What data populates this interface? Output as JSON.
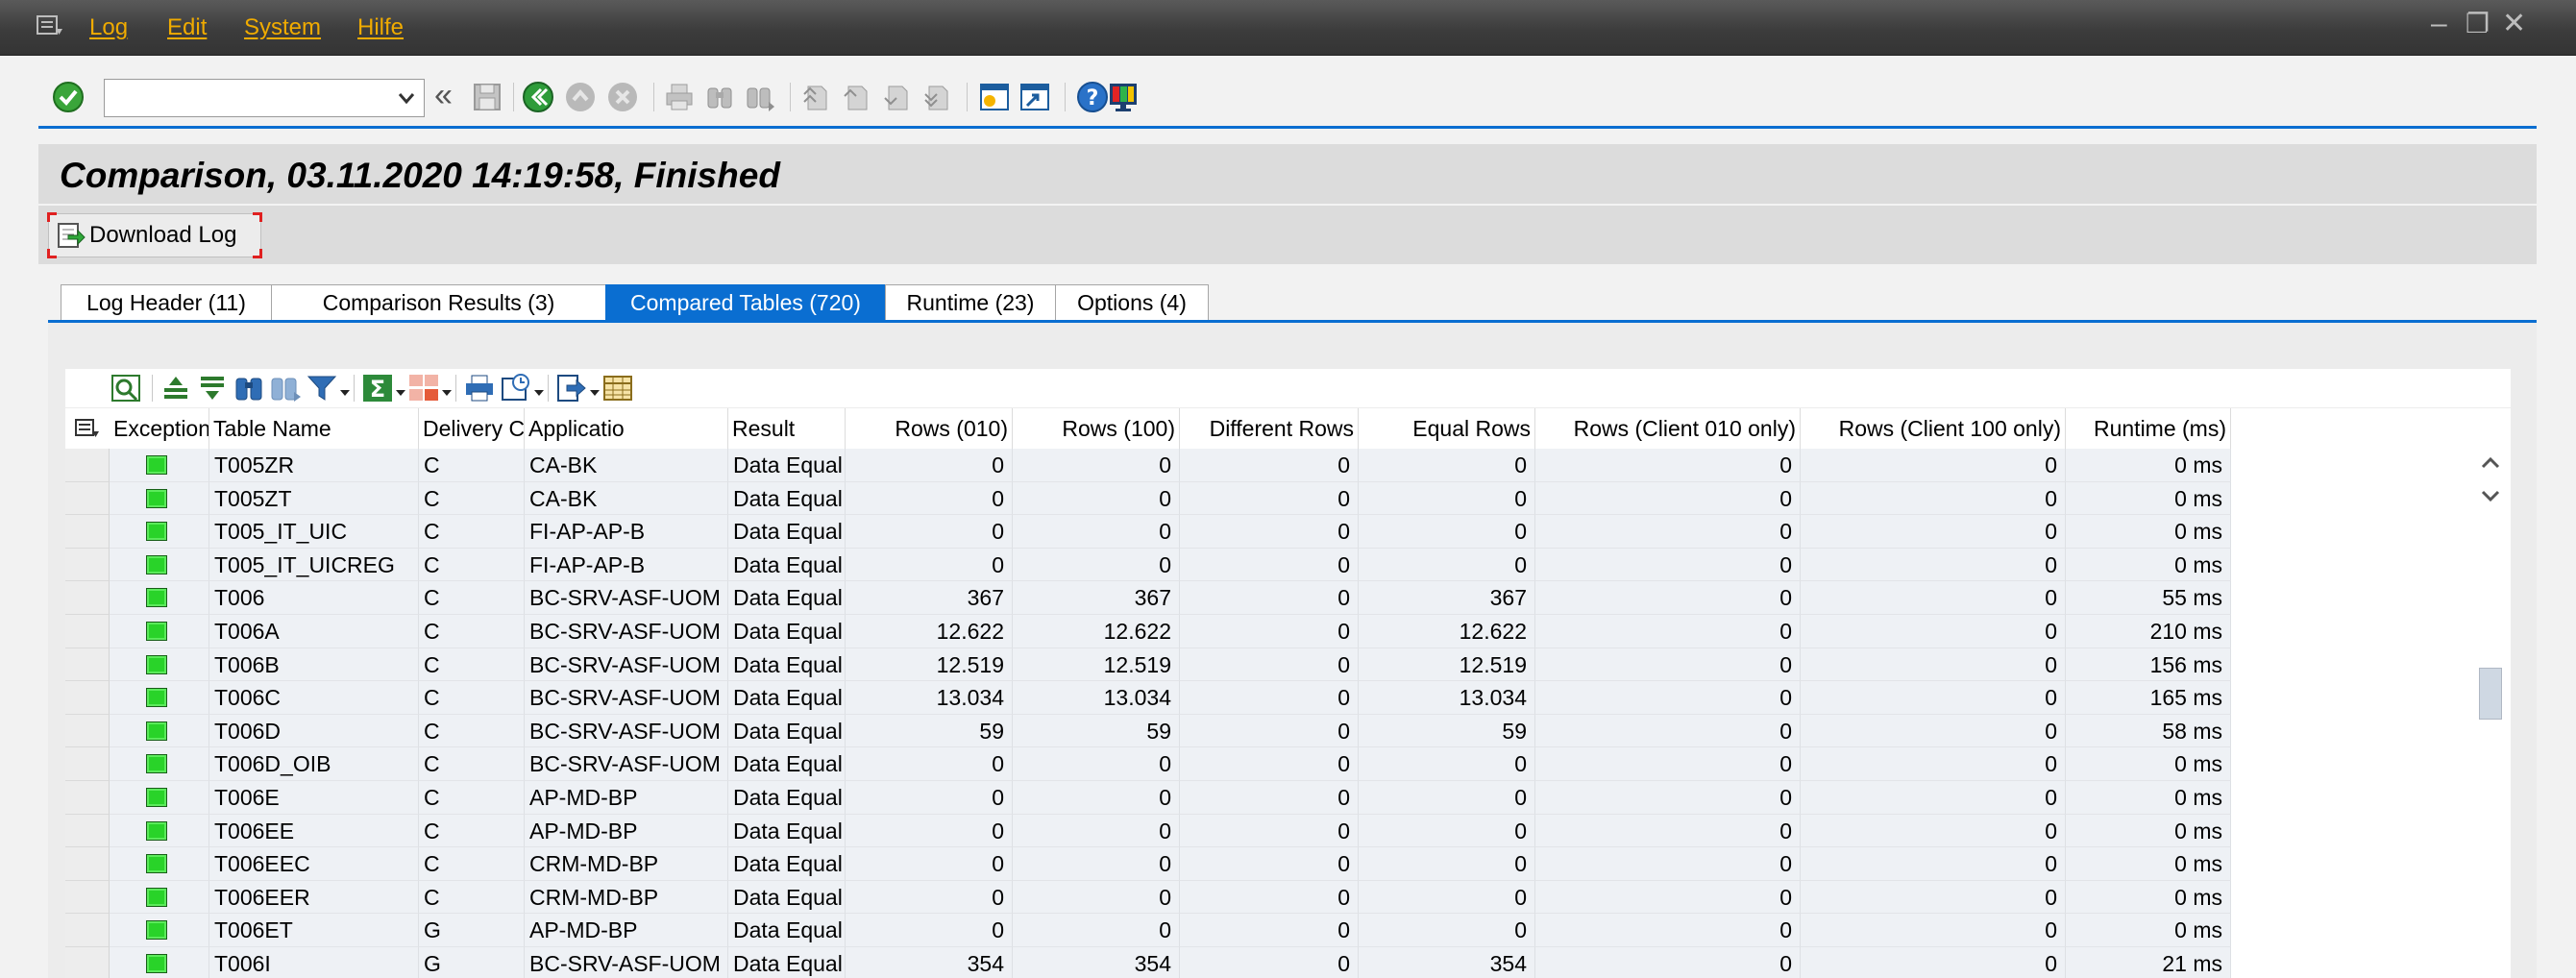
{
  "menubar": {
    "items": [
      "Log",
      "Edit",
      "System",
      "Hilfe"
    ],
    "window_controls": [
      "–",
      "❐",
      "✕"
    ]
  },
  "toolbar": {
    "command_value": "",
    "collapse_symbol": "«"
  },
  "title": "Comparison, 03.11.2020 14:19:58, Finished",
  "download_button_label": "Download Log",
  "tabs": [
    {
      "label": "Log Header (11)"
    },
    {
      "label": "Comparison Results (3)"
    },
    {
      "label": "Compared Tables (720)"
    },
    {
      "label": "Runtime (23)"
    },
    {
      "label": "Options (4)"
    }
  ],
  "active_tab": 2,
  "grid": {
    "columns": [
      "Exception",
      "Table Name",
      "Delivery C",
      "Applicatio",
      "Result",
      "Rows (010)",
      "Rows (100)",
      "Different Rows",
      "Equal Rows",
      "Rows (Client 010 only)",
      "Rows (Client 100 only)",
      "Runtime (ms)"
    ],
    "rows": [
      {
        "table": "T005ZR",
        "delivery": "C",
        "app": "CA-BK",
        "result": "Data Equal",
        "rows010": "0",
        "rows100": "0",
        "diff": "0",
        "equal": "0",
        "only010": "0",
        "only100": "0",
        "runtime": "0 ms"
      },
      {
        "table": "T005ZT",
        "delivery": "C",
        "app": "CA-BK",
        "result": "Data Equal",
        "rows010": "0",
        "rows100": "0",
        "diff": "0",
        "equal": "0",
        "only010": "0",
        "only100": "0",
        "runtime": "0 ms"
      },
      {
        "table": "T005_IT_UIC",
        "delivery": "C",
        "app": "FI-AP-AP-B",
        "result": "Data Equal",
        "rows010": "0",
        "rows100": "0",
        "diff": "0",
        "equal": "0",
        "only010": "0",
        "only100": "0",
        "runtime": "0 ms"
      },
      {
        "table": "T005_IT_UICREG",
        "delivery": "C",
        "app": "FI-AP-AP-B",
        "result": "Data Equal",
        "rows010": "0",
        "rows100": "0",
        "diff": "0",
        "equal": "0",
        "only010": "0",
        "only100": "0",
        "runtime": "0 ms"
      },
      {
        "table": "T006",
        "delivery": "C",
        "app": "BC-SRV-ASF-UOM",
        "result": "Data Equal",
        "rows010": "367",
        "rows100": "367",
        "diff": "0",
        "equal": "367",
        "only010": "0",
        "only100": "0",
        "runtime": "55 ms"
      },
      {
        "table": "T006A",
        "delivery": "C",
        "app": "BC-SRV-ASF-UOM",
        "result": "Data Equal",
        "rows010": "12.622",
        "rows100": "12.622",
        "diff": "0",
        "equal": "12.622",
        "only010": "0",
        "only100": "0",
        "runtime": "210 ms"
      },
      {
        "table": "T006B",
        "delivery": "C",
        "app": "BC-SRV-ASF-UOM",
        "result": "Data Equal",
        "rows010": "12.519",
        "rows100": "12.519",
        "diff": "0",
        "equal": "12.519",
        "only010": "0",
        "only100": "0",
        "runtime": "156 ms"
      },
      {
        "table": "T006C",
        "delivery": "C",
        "app": "BC-SRV-ASF-UOM",
        "result": "Data Equal",
        "rows010": "13.034",
        "rows100": "13.034",
        "diff": "0",
        "equal": "13.034",
        "only010": "0",
        "only100": "0",
        "runtime": "165 ms"
      },
      {
        "table": "T006D",
        "delivery": "C",
        "app": "BC-SRV-ASF-UOM",
        "result": "Data Equal",
        "rows010": "59",
        "rows100": "59",
        "diff": "0",
        "equal": "59",
        "only010": "0",
        "only100": "0",
        "runtime": "58 ms"
      },
      {
        "table": "T006D_OIB",
        "delivery": "C",
        "app": "BC-SRV-ASF-UOM",
        "result": "Data Equal",
        "rows010": "0",
        "rows100": "0",
        "diff": "0",
        "equal": "0",
        "only010": "0",
        "only100": "0",
        "runtime": "0 ms"
      },
      {
        "table": "T006E",
        "delivery": "C",
        "app": "AP-MD-BP",
        "result": "Data Equal",
        "rows010": "0",
        "rows100": "0",
        "diff": "0",
        "equal": "0",
        "only010": "0",
        "only100": "0",
        "runtime": "0 ms"
      },
      {
        "table": "T006EE",
        "delivery": "C",
        "app": "AP-MD-BP",
        "result": "Data Equal",
        "rows010": "0",
        "rows100": "0",
        "diff": "0",
        "equal": "0",
        "only010": "0",
        "only100": "0",
        "runtime": "0 ms"
      },
      {
        "table": "T006EEC",
        "delivery": "C",
        "app": "CRM-MD-BP",
        "result": "Data Equal",
        "rows010": "0",
        "rows100": "0",
        "diff": "0",
        "equal": "0",
        "only010": "0",
        "only100": "0",
        "runtime": "0 ms"
      },
      {
        "table": "T006EER",
        "delivery": "C",
        "app": "CRM-MD-BP",
        "result": "Data Equal",
        "rows010": "0",
        "rows100": "0",
        "diff": "0",
        "equal": "0",
        "only010": "0",
        "only100": "0",
        "runtime": "0 ms"
      },
      {
        "table": "T006ET",
        "delivery": "G",
        "app": "AP-MD-BP",
        "result": "Data Equal",
        "rows010": "0",
        "rows100": "0",
        "diff": "0",
        "equal": "0",
        "only010": "0",
        "only100": "0",
        "runtime": "0 ms"
      },
      {
        "table": "T006I",
        "delivery": "G",
        "app": "BC-SRV-ASF-UOM",
        "result": "Data Equal",
        "rows010": "354",
        "rows100": "354",
        "diff": "0",
        "equal": "354",
        "only010": "0",
        "only100": "0",
        "runtime": "21 ms"
      }
    ]
  },
  "colors": {
    "menubar": "#3c3c3c",
    "menu_text": "#f0ab00",
    "accent": "#0a6ed1",
    "led_green": "#29d329"
  },
  "icons": {
    "menu": "menu-icon",
    "enter": "check-icon",
    "save": "save-icon",
    "back": "back-icon",
    "exit": "exit-icon",
    "cancel": "cancel-icon",
    "print": "print-icon",
    "find": "find-icon",
    "find_next": "find-next-icon",
    "first_page": "first-page-icon",
    "prev_page": "prev-page-icon",
    "next_page": "next-page-icon",
    "last_page": "last-page-icon",
    "new_session": "new-session-icon",
    "shortcut": "shortcut-icon",
    "help": "help-icon",
    "customize": "customize-layout-icon"
  }
}
